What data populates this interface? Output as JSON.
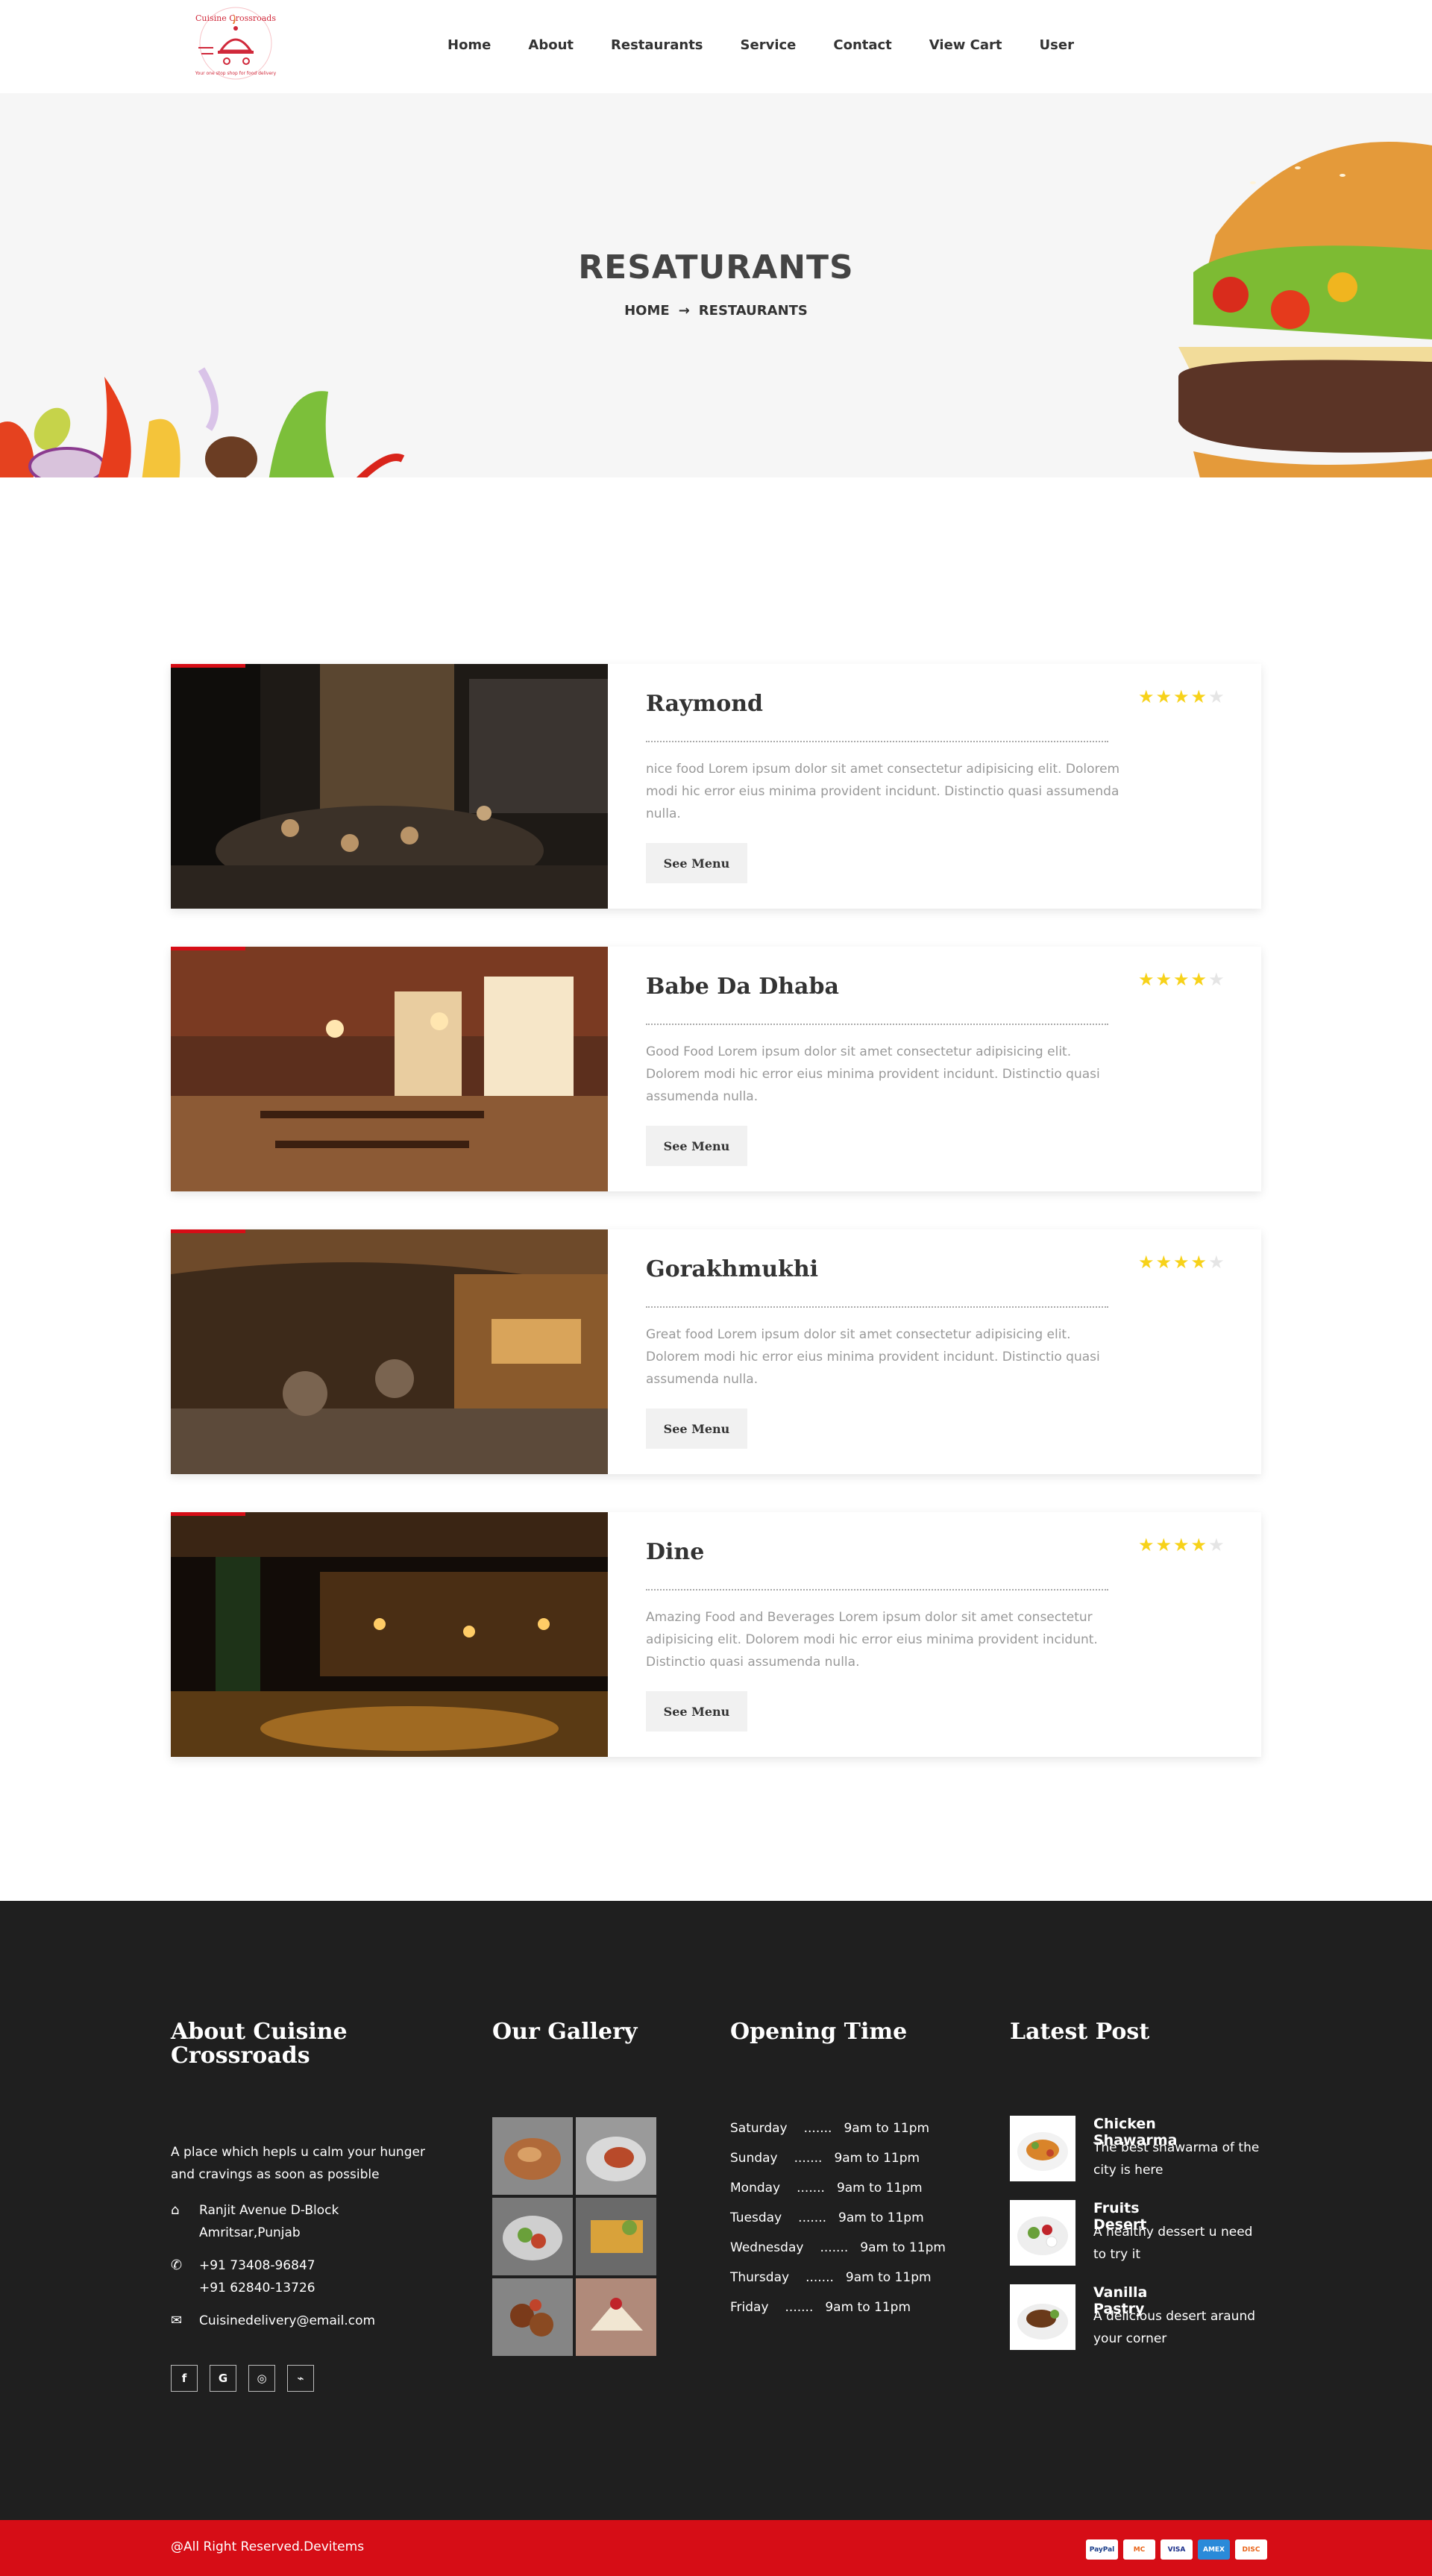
{
  "brand": {
    "name": "Cuisine Crossroads",
    "tagline": "Your one stop shop for food delivery"
  },
  "nav": [
    "Home",
    "About",
    "Restaurants",
    "Service",
    "Contact",
    "View Cart",
    "User"
  ],
  "hero": {
    "title": "RESATURANTS",
    "breadcrumb_home": "HOME",
    "breadcrumb_arrow": "→",
    "breadcrumb_current": "RESTAURANTS"
  },
  "restaurants": [
    {
      "name": "Raymond",
      "rating": 4,
      "max_rating": 5,
      "description": "nice food Lorem ipsum dolor sit amet consectetur adipisicing elit. Dolorem modi hic error eius minima provident incidunt. Distinctio quasi assumenda nulla.",
      "button": "See Menu"
    },
    {
      "name": "Babe Da Dhaba",
      "rating": 4,
      "max_rating": 5,
      "description": "Good Food Lorem ipsum dolor sit amet consectetur adipisicing elit. Dolorem modi hic error eius minima provident incidunt. Distinctio quasi assumenda nulla.",
      "button": "See Menu"
    },
    {
      "name": "Gorakhmukhi",
      "rating": 4,
      "max_rating": 5,
      "description": "Great food Lorem ipsum dolor sit amet consectetur adipisicing elit. Dolorem modi hic error eius minima provident incidunt. Distinctio quasi assumenda nulla.",
      "button": "See Menu"
    },
    {
      "name": "Dine",
      "rating": 4,
      "max_rating": 5,
      "description": "Amazing Food and Beverages Lorem ipsum dolor sit amet consectetur adipisicing elit. Dolorem modi hic error eius minima provident incidunt. Distinctio quasi assumenda nulla.",
      "button": "See Menu"
    }
  ],
  "footer": {
    "about": {
      "title": "About Cuisine Crossroads",
      "text": "A place which hepls u calm your hunger and cravings as soon as possible",
      "address_line1": "Ranjit Avenue D-Block",
      "address_line2": "Amritsar,Punjab",
      "phone1": "+91 73408-96847",
      "phone2": "+91 62840-13726",
      "email": "Cuisinedelivery@email.com",
      "socials": [
        "f",
        "G",
        "◎",
        "⌁"
      ]
    },
    "gallery": {
      "title": "Our Gallery"
    },
    "hours": {
      "title": "Opening Time",
      "rows": [
        {
          "day": "Saturday",
          "dots": ".......",
          "time": "9am to 11pm"
        },
        {
          "day": "Sunday",
          "dots": ".......",
          "time": "9am to 11pm"
        },
        {
          "day": "Monday",
          "dots": ".......",
          "time": "9am to 11pm"
        },
        {
          "day": "Tuesday",
          "dots": ".......",
          "time": "9am to 11pm"
        },
        {
          "day": "Wednesday",
          "dots": ".......",
          "time": "9am to 11pm"
        },
        {
          "day": "Thursday",
          "dots": ".......",
          "time": "9am to 11pm"
        },
        {
          "day": "Friday",
          "dots": ".......",
          "time": "9am to 11pm"
        }
      ]
    },
    "posts": {
      "title": "Latest Post",
      "items": [
        {
          "title": "Chicken Shawarma",
          "desc": "The best shawarma of the city is here"
        },
        {
          "title": "Fruits Desert",
          "desc": "A healthy dessert u need to try it"
        },
        {
          "title": "Vanilla Pastry",
          "desc": "A delicious desert araund your corner"
        }
      ]
    },
    "copyright": "@All Right Reserved.Devitems",
    "payments": [
      "PayPal",
      "MC",
      "VISA",
      "AMEX",
      "DISC"
    ]
  },
  "colors": {
    "accent": "#d60d16",
    "star": "#f7d21a",
    "footer_bg": "#1f1f1f",
    "hero_bg": "#f6f6f6"
  }
}
